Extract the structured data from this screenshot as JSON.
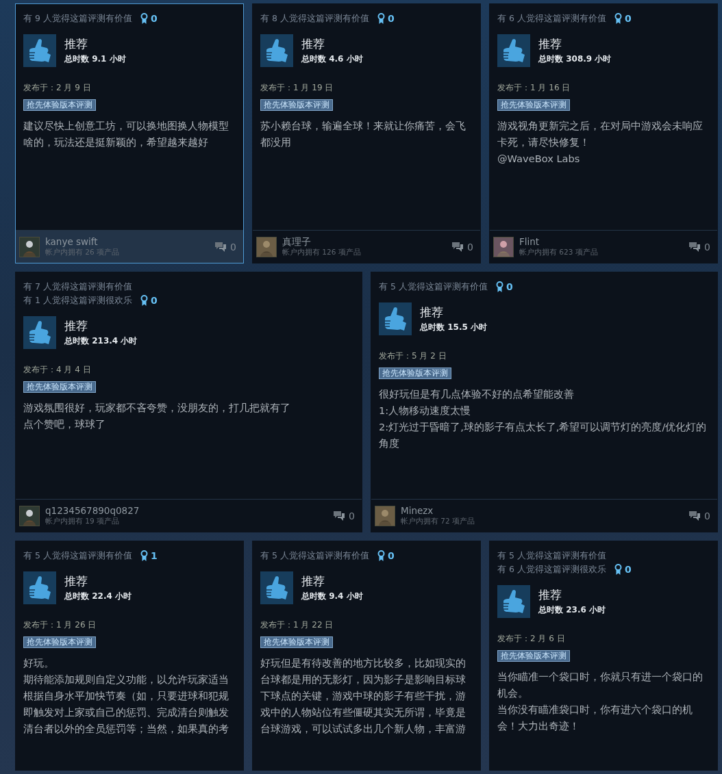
{
  "rows": [
    {
      "reviews": [
        {
          "selected": true,
          "helpful": [
            "有 9 人觉得这篇评测有价值"
          ],
          "awards": "0",
          "verdict": "推荐",
          "hours": "总时数 9.1 小时",
          "date": "发布于：2 月 9 日",
          "badge": "抢先体验版本评测",
          "body": [
            "建议尽快上创意工坊，可以换地图换人物模型啥的，玩法还是挺新颖的，希望越来越好"
          ],
          "footer": {
            "name": "kanye swift",
            "products": "帐户内拥有 26 项产品",
            "comments": "0"
          }
        },
        {
          "selected": false,
          "helpful": [
            "有 8 人觉得这篇评测有价值"
          ],
          "awards": "0",
          "verdict": "推荐",
          "hours": "总时数 4.6 小时",
          "date": "发布于：1 月 19 日",
          "badge": "抢先体验版本评测",
          "body": [
            "苏小赖台球，输遍全球！来就让你痛苦，会飞都没用"
          ],
          "footer": {
            "name": "真理子",
            "products": "帐户内拥有 126 项产品",
            "comments": "0"
          }
        },
        {
          "selected": false,
          "helpful": [
            "有 6 人觉得这篇评测有价值"
          ],
          "awards": "0",
          "verdict": "推荐",
          "hours": "总时数 308.9 小时",
          "date": "发布于：1 月 16 日",
          "badge": "抢先体验版本评测",
          "body": [
            "游戏视角更新完之后，在对局中游戏会未响应卡死，请尽快修复！",
            "@WaveBox Labs"
          ],
          "footer": {
            "name": "Flint",
            "products": "帐户内拥有 623 项产品",
            "comments": "0"
          }
        }
      ]
    },
    {
      "reviews": [
        {
          "selected": false,
          "helpful": [
            "有 7 人觉得这篇评测有价值",
            "有 1 人觉得这篇评测很欢乐"
          ],
          "awards": "0",
          "verdict": "推荐",
          "hours": "总时数 213.4 小时",
          "date": "发布于：4 月 4 日",
          "badge": "抢先体验版本评测",
          "body": [
            "游戏氛围很好，玩家都不吝夸赞，没朋友的，打几把就有了",
            "点个赞吧，球球了"
          ],
          "footer": {
            "name": "q1234567890q0827",
            "products": "帐户内拥有 19 项产品",
            "comments": "0"
          }
        },
        {
          "selected": false,
          "helpful": [
            "有 5 人觉得这篇评测有价值"
          ],
          "awards": "0",
          "verdict": "推荐",
          "hours": "总时数 15.5 小时",
          "date": "发布于：5 月 2 日",
          "badge": "抢先体验版本评测",
          "body": [
            "很好玩但是有几点体验不好的点希望能改善",
            "1:人物移动速度太慢",
            "2:灯光过于昏暗了,球的影子有点太长了,希望可以调节灯的亮度/优化灯的角度"
          ],
          "footer": {
            "name": "Minezx",
            "products": "帐户内拥有 72 项产品",
            "comments": "0"
          }
        }
      ]
    },
    {
      "reviews": [
        {
          "selected": false,
          "helpful": [
            "有 5 人觉得这篇评测有价值"
          ],
          "awards": "1",
          "verdict": "推荐",
          "hours": "总时数 22.4 小时",
          "date": "发布于：1 月 26 日",
          "badge": "抢先体验版本评测",
          "body": [
            "好玩。",
            "期待能添加规则自定义功能，以允许玩家适当根据自身水平加快节奏（如，只要进球和犯规即触发对上家或自己的惩罚、完成清台则触发清台者以外的全员惩罚等；当然，如果真的考"
          ]
        },
        {
          "selected": false,
          "helpful": [
            "有 5 人觉得这篇评测有价值"
          ],
          "awards": "0",
          "verdict": "推荐",
          "hours": "总时数 9.4 小时",
          "date": "发布于：1 月 22 日",
          "badge": "抢先体验版本评测",
          "body": [
            "好玩但是有待改善的地方比较多，比如现实的台球都是用的无影灯，因为影子是影响目标球下球点的关键，游戏中球的影子有些干扰，游戏中的人物站位有些僵硬其实无所谓，毕竟是台球游戏，可以试试多出几个新人物，丰富游"
          ]
        },
        {
          "selected": false,
          "helpful": [
            "有 5 人觉得这篇评测有价值",
            "有 6 人觉得这篇评测很欢乐"
          ],
          "awards": "0",
          "verdict": "推荐",
          "hours": "总时数 23.6 小时",
          "date": "发布于：2 月 6 日",
          "badge": "抢先体验版本评测",
          "body": [
            "当你瞄准一个袋口时，你就只有进一个袋口的机会。",
            "当你没有瞄准袋口时，你有进六个袋口的机会！大力出奇迹！"
          ]
        }
      ]
    }
  ]
}
